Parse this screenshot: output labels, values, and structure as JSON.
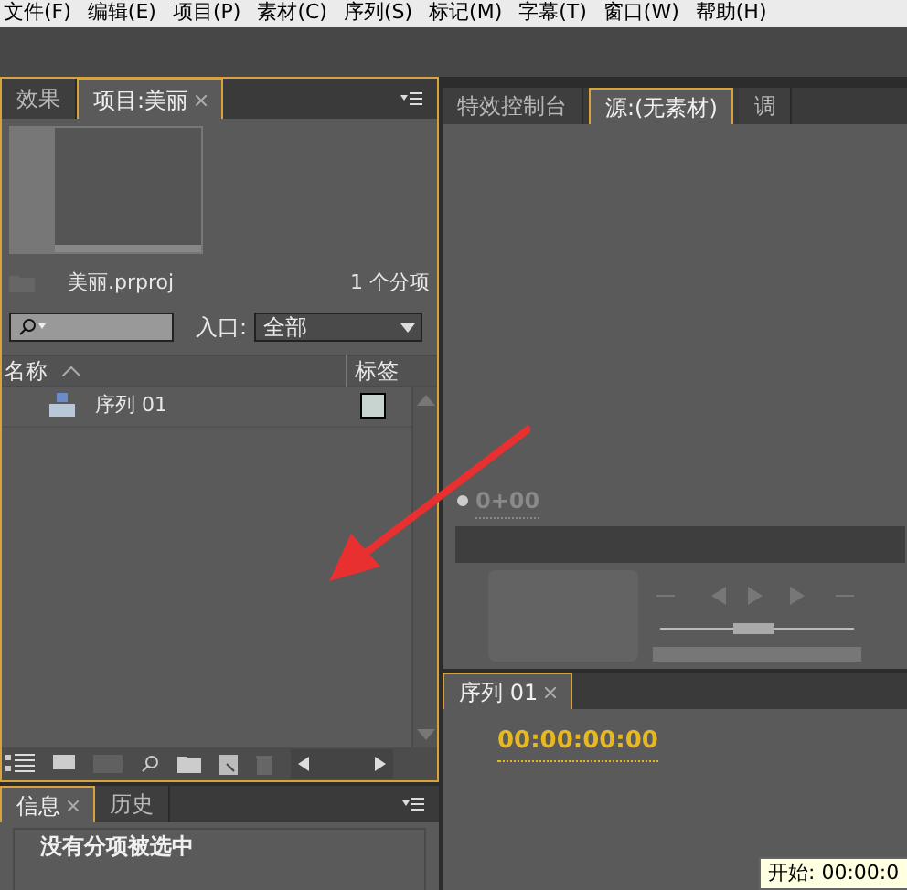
{
  "menu_bar": [
    "文件(F)",
    "编辑(E)",
    "项目(P)",
    "素材(C)",
    "序列(S)",
    "标记(M)",
    "字幕(T)",
    "窗口(W)",
    "帮助(H)"
  ],
  "project_panel": {
    "tabs": [
      {
        "label": "效果",
        "selected": false
      },
      {
        "label": "项目:美丽",
        "selected": true
      }
    ],
    "file_name": "美丽.prproj",
    "item_count": "1 个分项",
    "entry_label": "入口:",
    "entry_value": "全部",
    "columns": [
      "名称",
      "标签"
    ],
    "items": [
      {
        "name": "序列 01",
        "color": "#c8d4d0"
      }
    ]
  },
  "info_panel": {
    "tabs": [
      {
        "label": "信息",
        "selected": true
      },
      {
        "label": "历史",
        "selected": false
      }
    ],
    "message": "没有分项被选中"
  },
  "monitor_panel": {
    "tabs": [
      {
        "label": "特效控制台",
        "selected": false
      },
      {
        "label": "源:(无素材)",
        "selected": true
      },
      {
        "label": "调",
        "selected": false
      }
    ],
    "timecode": "0+00"
  },
  "timeline_panel": {
    "tab": "序列 01",
    "timecode": "00:00:00:00",
    "tooltip": "开始: 00:00:0"
  }
}
